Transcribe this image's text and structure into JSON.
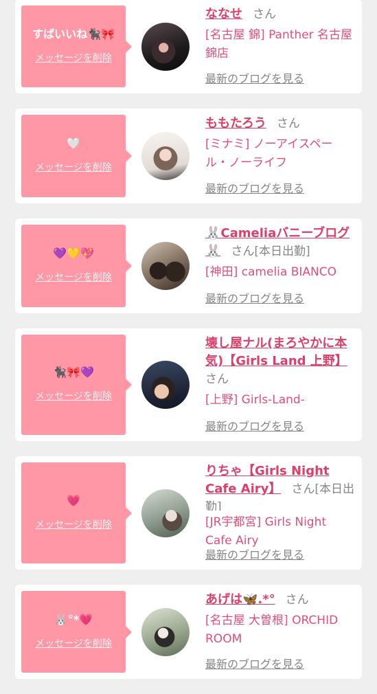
{
  "colors": {
    "page_background": "#efefef",
    "card_background": "#ffffff",
    "bubble": "#ff97a7",
    "name": "#dc3f69",
    "shop": "#e24e78",
    "muted": "#858585"
  },
  "messages": [
    {
      "message": "すばいいね🐈‍⬛🎀",
      "delete_label": "メッセージを削除",
      "name": "ななせ",
      "honorific": "さん",
      "shop": "[名古屋 錦] Panther 名古屋錦店",
      "blog_link": "最新のブログを見る"
    },
    {
      "message": "🤍",
      "delete_label": "メッセージを削除",
      "name": "ももたろう",
      "honorific": "さん",
      "shop": "[ミナミ] ノーアイスペール・ノーライフ",
      "blog_link": "最新のブログを見る"
    },
    {
      "message": "💜💛💖",
      "delete_label": "メッセージを削除",
      "name": "🐰Cameliaバニーブログ🐰",
      "honorific": "さん",
      "status": "[本日出勤]",
      "shop": "[神田] camelia BIANCO",
      "blog_link": "最新のブログを見る"
    },
    {
      "message": "🐈‍⬛🎀💜",
      "delete_label": "メッセージを削除",
      "name": "壊し屋ナル(まろやかに本気)【Girls Land 上野】",
      "honorific": "さん",
      "shop": "[上野] Girls-Land-",
      "blog_link": "最新のブログを見る"
    },
    {
      "message": "💗",
      "delete_label": "メッセージを削除",
      "name": "りちゃ【Girls Night Cafe Airy】",
      "honorific": "さん",
      "status": "[本日出勤]",
      "shop": "[JR宇都宮] Girls Night Cafe Airy",
      "blog_link": "最新のブログを見る"
    },
    {
      "message": "🐰°*💗",
      "delete_label": "メッセージを削除",
      "name": "あげは🦋.*°",
      "honorific": "さん",
      "shop": "[名古屋 大曽根] ORCHID ROOM",
      "blog_link": "最新のブログを見る"
    }
  ]
}
